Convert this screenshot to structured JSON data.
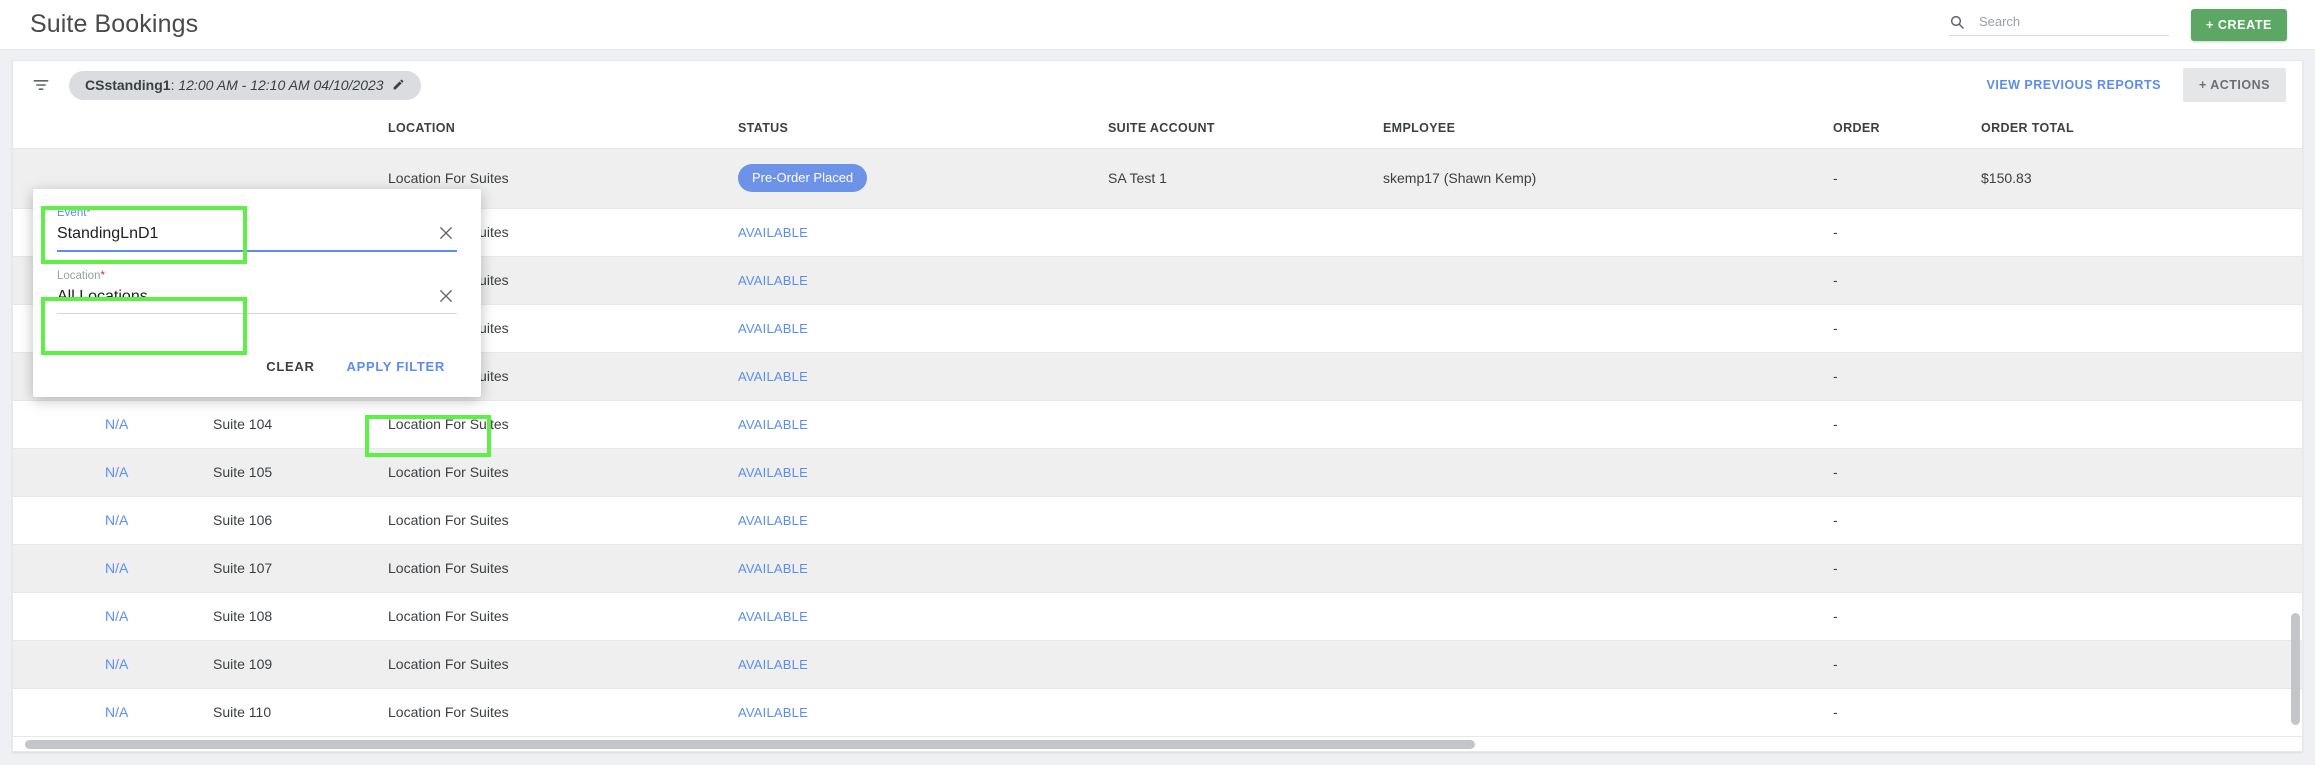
{
  "appbar": {
    "title": "Suite Bookings",
    "search": {
      "placeholder": "Search",
      "value": "",
      "icon": "search-icon"
    },
    "create_label": "+ CREATE",
    "create_color": "#5aa864"
  },
  "toolbar": {
    "filter_icon": "filter-list-icon",
    "chip": {
      "name": "CSstanding1",
      "separator": ": ",
      "range": "12:00 AM - 12:10 AM 04/10/2023",
      "edit_icon": "pencil-icon"
    },
    "view_previous_reports": "VIEW PREVIOUS REPORTS",
    "actions": "+ ACTIONS"
  },
  "filter_popup": {
    "event": {
      "label": "Event",
      "required_mark": "*",
      "value": "StandingLnD1",
      "focused": true,
      "clear_icon": "close-icon"
    },
    "location": {
      "label": "Location",
      "required_mark": "*",
      "value": "All Locations",
      "focused": false,
      "clear_icon": "close-icon"
    },
    "clear_label": "CLEAR",
    "apply_label": "APPLY FILTER",
    "highlight_color": "#5ef046"
  },
  "table": {
    "columns": [
      {
        "key": "booking",
        "label": ""
      },
      {
        "key": "suite",
        "label": ""
      },
      {
        "key": "location",
        "label": "LOCATION"
      },
      {
        "key": "status",
        "label": "STATUS"
      },
      {
        "key": "suite_account",
        "label": "SUITE ACCOUNT"
      },
      {
        "key": "employee",
        "label": "EMPLOYEE"
      },
      {
        "key": "order",
        "label": "ORDER"
      },
      {
        "key": "order_total",
        "label": "ORDER TOTAL"
      }
    ],
    "rows": [
      {
        "booking": "",
        "suite": "",
        "location": "Location For Suites",
        "status": "Pre-Order Placed",
        "status_type": "badge",
        "suite_account": "SA Test 1",
        "employee": "skemp17 (Shawn Kemp)",
        "order": "-",
        "order_total": "$150.83"
      },
      {
        "booking": "",
        "suite": "",
        "location": "Location For Suites",
        "status": "AVAILABLE",
        "status_type": "link",
        "suite_account": "",
        "employee": "",
        "order": "-",
        "order_total": ""
      },
      {
        "booking": "",
        "suite": "",
        "location": "Location For Suites",
        "status": "AVAILABLE",
        "status_type": "link",
        "suite_account": "",
        "employee": "",
        "order": "-",
        "order_total": ""
      },
      {
        "booking": "",
        "suite": "",
        "location": "Location For Suites",
        "status": "AVAILABLE",
        "status_type": "link",
        "suite_account": "",
        "employee": "",
        "order": "-",
        "order_total": ""
      },
      {
        "booking": "",
        "suite": "",
        "location": "Location For Suites",
        "status": "AVAILABLE",
        "status_type": "link",
        "suite_account": "",
        "employee": "",
        "order": "-",
        "order_total": ""
      },
      {
        "booking": "N/A",
        "suite": "Suite 104",
        "location": "Location For Suites",
        "status": "AVAILABLE",
        "status_type": "link",
        "suite_account": "",
        "employee": "",
        "order": "-",
        "order_total": ""
      },
      {
        "booking": "N/A",
        "suite": "Suite 105",
        "location": "Location For Suites",
        "status": "AVAILABLE",
        "status_type": "link",
        "suite_account": "",
        "employee": "",
        "order": "-",
        "order_total": ""
      },
      {
        "booking": "N/A",
        "suite": "Suite 106",
        "location": "Location For Suites",
        "status": "AVAILABLE",
        "status_type": "link",
        "suite_account": "",
        "employee": "",
        "order": "-",
        "order_total": ""
      },
      {
        "booking": "N/A",
        "suite": "Suite 107",
        "location": "Location For Suites",
        "status": "AVAILABLE",
        "status_type": "link",
        "suite_account": "",
        "employee": "",
        "order": "-",
        "order_total": ""
      },
      {
        "booking": "N/A",
        "suite": "Suite 108",
        "location": "Location For Suites",
        "status": "AVAILABLE",
        "status_type": "link",
        "suite_account": "",
        "employee": "",
        "order": "-",
        "order_total": ""
      },
      {
        "booking": "N/A",
        "suite": "Suite 109",
        "location": "Location For Suites",
        "status": "AVAILABLE",
        "status_type": "link",
        "suite_account": "",
        "employee": "",
        "order": "-",
        "order_total": ""
      },
      {
        "booking": "N/A",
        "suite": "Suite 110",
        "location": "Location For Suites",
        "status": "AVAILABLE",
        "status_type": "link",
        "suite_account": "",
        "employee": "",
        "order": "-",
        "order_total": ""
      }
    ]
  },
  "colors": {
    "accent_blue": "#5b8def",
    "badge_blue": "#6d93e8",
    "create_green": "#5aa864",
    "row_stripe": "#efefef",
    "highlight_green": "#5ef046"
  }
}
